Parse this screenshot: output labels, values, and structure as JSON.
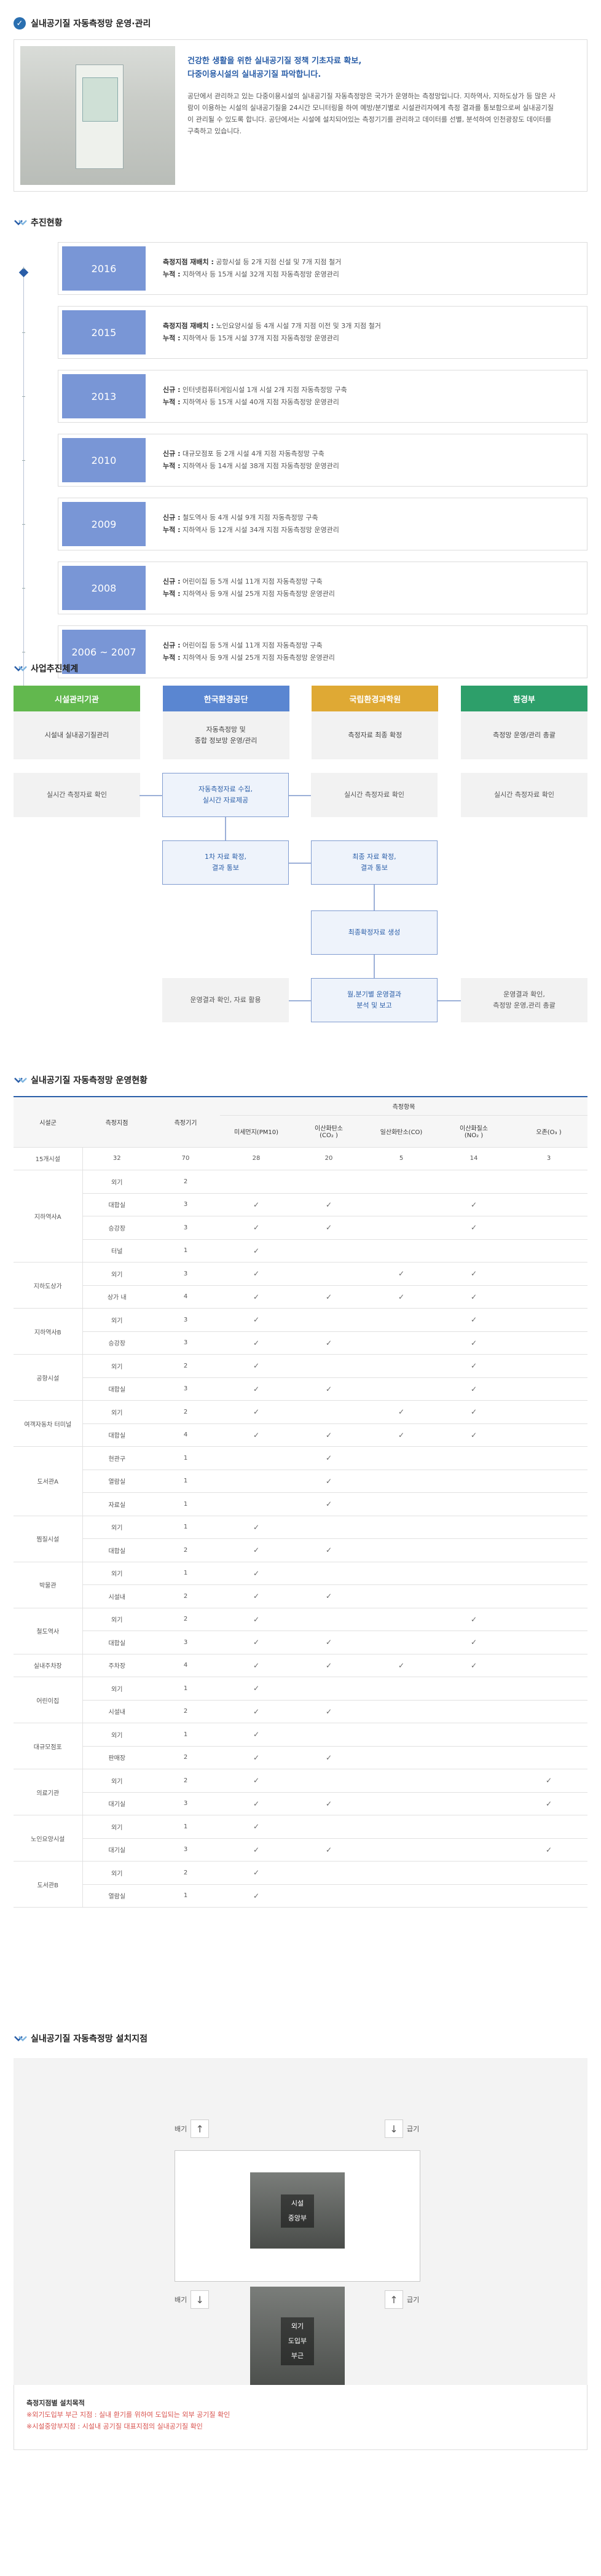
{
  "intro": {
    "title": "실내공기질 자동측정망 운영·관리",
    "highlight1": "건강한 생활을 위한 실내공기질 정책 기초자료 확보,",
    "highlight2": "다중이용시설의 실내공기질 파악합니다.",
    "body": "공단에서 관리하고 있는 다중이용시설의 실내공기질 자동측정망은 국가가 운영하는 측정망입니다. 지하역사, 지하도상가 등 많은 사람이 이용하는 시설의 실내공기질을 24시간 모니터링을 하여 예방/분기별로 시설관리자에게 측정 결과를 통보함으로써 실내공기질이 관리될 수 있도록 합니다. 공단에서는 시설에 설치되어있는 측정기기를 관리하고 데이터를 선별, 분석하여 인천광장도 데이터를 구축하고 있습니다."
  },
  "timeline": {
    "title": "추진현황",
    "rows": [
      {
        "year": "2016",
        "l1k": "측정지점 재배치 :",
        "l1": " 공항시설 등 2개 지점 신설 및 7개 지점 철거",
        "l2k": "누적 :",
        "l2": " 지하역사 등 15개 시설 32개 지점 자동측정망 운영관리"
      },
      {
        "year": "2015",
        "l1k": "측정지점 재배치 :",
        "l1": " 노인요양시설 등 4개 시설 7개 지점 이전 및 3개 지점 철거",
        "l2k": "누적 :",
        "l2": " 지하역사 등 15개 시설 37개 지점 자동측정망 운영관리"
      },
      {
        "year": "2013",
        "l1k": "신규 :",
        "l1": " 인터넷컴퓨터게임시설 1개 시설 2개 지점 자동측정망 구축",
        "l2k": "누적 :",
        "l2": " 지하역사 등 15개 시설 40개 지점 자동측정망 운영관리"
      },
      {
        "year": "2010",
        "l1k": "신규 :",
        "l1": " 대규모점포 등 2개 시설 4개 지점 자동측정망 구축",
        "l2k": "누적 :",
        "l2": " 지하역사 등 14개 시설 38개 지점 자동측정망 운영관리"
      },
      {
        "year": "2009",
        "l1k": "신규 :",
        "l1": " 철도역사 등 4개 시설 9개 지점 자동측정망 구축",
        "l2k": "누적 :",
        "l2": " 지하역사 등 12개 시설 34개 지점 자동측정망 운영관리"
      },
      {
        "year": "2008",
        "l1k": "신규 :",
        "l1": " 어린이집 등 5개 시설 11개 지점 자동측정망 구축",
        "l2k": "누적 :",
        "l2": " 지하역사 등 9개 시설 25개 지점 자동측정망 운영관리"
      },
      {
        "year": "2006 ~ 2007",
        "l1k": "신규 :",
        "l1": " 어린이집 등 5개 시설 11개 지점 자동측정망 구축",
        "l2k": "누적 :",
        "l2": " 지하역사 등 9개 시설 25개 지점 자동측정망 운영관리"
      }
    ]
  },
  "system": {
    "title": "사업추진체계",
    "heads": [
      {
        "label": "시설관리기관",
        "color": "#62b84e",
        "desc1": "시설내 실내공기질관리",
        "desc2": ""
      },
      {
        "label": "한국환경공단",
        "color": "#5a86d1",
        "desc1": "자동측정망 및",
        "desc2": "종합 정보망 운영/관리"
      },
      {
        "label": "국립환경과학원",
        "color": "#dfa934",
        "desc1": "측정자료 최종 확정",
        "desc2": ""
      },
      {
        "label": "환경부",
        "color": "#2d9f6a",
        "desc1": "측정망 운영/관리 총괄",
        "desc2": ""
      }
    ],
    "flow": {
      "a1": "실시간 측정자료 확인",
      "a2": "자동측정자료 수집,",
      "a2b": "실시간 자료제공",
      "a3": "실시간 측정자료 확인",
      "a4": "실시간 측정자료 확인",
      "b1": "1차 자료 확정,",
      "b1b": "결과 통보",
      "b2": "최종 자료 확정,",
      "b2b": "결과 통보",
      "c1": "최종확정자료 생성",
      "d1": "운영결과 확인, 자료 활용",
      "d2": "월,분기별 운영결과",
      "d2b": "분석 및 보고",
      "d3": "운영결과 확인,",
      "d3b": "측정망 운영,관리 총괄"
    }
  },
  "table": {
    "title": "실내공기질 자동측정망 운영현황",
    "headers": {
      "facility": "시설군",
      "site": "측정지점",
      "count": "측정기기",
      "items": "측정항목",
      "pm10": "미세먼지(PM10)",
      "co2a": "이산화탄소",
      "co2b": "(CO₂ )",
      "co": "일산화탄소(CO)",
      "no2a": "이산화질소",
      "no2b": "(NO₂ )",
      "o3": "오존(O₃ )"
    },
    "check": "✓",
    "total": {
      "facility": "15개시설",
      "site": "32",
      "count": "70",
      "pm10": "28",
      "co2": "20",
      "co": "5",
      "no2": "14",
      "o3": "3"
    },
    "rows": [
      {
        "group": "지하역사A",
        "span": 4,
        "site": "외기",
        "count": "2",
        "c": [
          0,
          0,
          0,
          0,
          0
        ]
      },
      {
        "site": "대합실",
        "count": "3",
        "c": [
          1,
          1,
          0,
          1,
          0
        ]
      },
      {
        "site": "승강장",
        "count": "3",
        "c": [
          1,
          1,
          0,
          1,
          0
        ]
      },
      {
        "site": "터널",
        "count": "1",
        "c": [
          1,
          0,
          0,
          0,
          0
        ]
      },
      {
        "group": "지하도상가",
        "span": 2,
        "site": "외기",
        "count": "3",
        "c": [
          1,
          0,
          1,
          1,
          0
        ]
      },
      {
        "site": "상가 내",
        "count": "4",
        "c": [
          1,
          1,
          1,
          1,
          0
        ]
      },
      {
        "group": "지하역사B",
        "span": 2,
        "site": "외기",
        "count": "3",
        "c": [
          1,
          0,
          0,
          1,
          0
        ]
      },
      {
        "site": "승강장",
        "count": "3",
        "c": [
          1,
          1,
          0,
          1,
          0
        ]
      },
      {
        "group": "공항시설",
        "span": 2,
        "site": "외기",
        "count": "2",
        "c": [
          1,
          0,
          0,
          1,
          0
        ]
      },
      {
        "site": "대합실",
        "count": "3",
        "c": [
          1,
          1,
          0,
          1,
          0
        ]
      },
      {
        "group": "여객자동차 터미널",
        "span": 2,
        "site": "외기",
        "count": "2",
        "c": [
          1,
          0,
          1,
          1,
          0
        ]
      },
      {
        "site": "대합실",
        "count": "4",
        "c": [
          1,
          1,
          1,
          1,
          0
        ]
      },
      {
        "group": "도서관A",
        "span": 3,
        "site": "현관구",
        "count": "1",
        "c": [
          0,
          1,
          0,
          0,
          0
        ]
      },
      {
        "site": "열람실",
        "count": "1",
        "c": [
          0,
          1,
          0,
          0,
          0
        ]
      },
      {
        "site": "자료실",
        "count": "1",
        "c": [
          0,
          1,
          0,
          0,
          0
        ]
      },
      {
        "group": "찜질시설",
        "span": 2,
        "site": "외기",
        "count": "1",
        "c": [
          1,
          0,
          0,
          0,
          0
        ]
      },
      {
        "site": "대합실",
        "count": "2",
        "c": [
          1,
          1,
          0,
          0,
          0
        ]
      },
      {
        "group": "박물관",
        "span": 2,
        "site": "외기",
        "count": "1",
        "c": [
          1,
          0,
          0,
          0,
          0
        ]
      },
      {
        "site": "시설내",
        "count": "2",
        "c": [
          1,
          1,
          0,
          0,
          0
        ]
      },
      {
        "group": "철도역사",
        "span": 2,
        "site": "외기",
        "count": "2",
        "c": [
          1,
          0,
          0,
          1,
          0
        ]
      },
      {
        "site": "대합실",
        "count": "3",
        "c": [
          1,
          1,
          0,
          1,
          0
        ]
      },
      {
        "group": "실내주차장",
        "span": 1,
        "site": "주차장",
        "count": "4",
        "c": [
          1,
          1,
          1,
          1,
          0
        ]
      },
      {
        "group": "어린이집",
        "span": 2,
        "site": "외기",
        "count": "1",
        "c": [
          1,
          0,
          0,
          0,
          0
        ]
      },
      {
        "site": "시설내",
        "count": "2",
        "c": [
          1,
          1,
          0,
          0,
          0
        ]
      },
      {
        "group": "대규모점포",
        "span": 2,
        "site": "외기",
        "count": "1",
        "c": [
          1,
          0,
          0,
          0,
          0
        ]
      },
      {
        "site": "판매장",
        "count": "2",
        "c": [
          1,
          1,
          0,
          0,
          0
        ]
      },
      {
        "group": "의료기관",
        "span": 2,
        "site": "외기",
        "count": "2",
        "c": [
          1,
          0,
          0,
          0,
          1
        ]
      },
      {
        "site": "대기실",
        "count": "3",
        "c": [
          1,
          1,
          0,
          0,
          1
        ]
      },
      {
        "group": "노인요양시설",
        "span": 2,
        "site": "외기",
        "count": "1",
        "c": [
          1,
          0,
          0,
          0,
          0
        ]
      },
      {
        "site": "대기실",
        "count": "3",
        "c": [
          1,
          1,
          0,
          0,
          1
        ]
      },
      {
        "group": "도서관B",
        "span": 2,
        "site": "외기",
        "count": "2",
        "c": [
          1,
          0,
          0,
          0,
          0
        ]
      },
      {
        "site": "열람실",
        "count": "1",
        "c": [
          1,
          0,
          0,
          0,
          0
        ]
      }
    ]
  },
  "site": {
    "title": "실내공기질 자동측정망 설치지점",
    "exhaust": "배기",
    "supply": "급기",
    "up": "↑",
    "down": "↓",
    "photo1a": "시설",
    "photo1b": "중앙부",
    "photo2a": "외기",
    "photo2b": "도입부",
    "photo2c": "부근",
    "noteTitle": "측정지점별 설치목적",
    "note1": "※외기도입부 부근 지점 : 실내 환기를 위하여 도입되는 외부 공기질 확인",
    "note2": "※시설중앙부지점 : 시설내 공기질 대표지점의 실내공기질 확인"
  }
}
